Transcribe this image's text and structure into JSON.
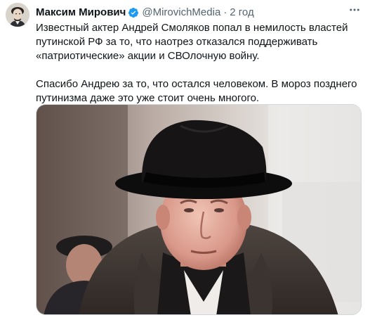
{
  "author": {
    "display_name": "Максим Мирович",
    "handle": "@MirovichMedia",
    "separator": "·",
    "time": "2 год",
    "verified_icon": "verified-badge-icon",
    "avatar_icon": "avatar-portrait"
  },
  "tweet": {
    "paragraph_1": "Известный актер Андрей Смоляков попал в немилость властей путинской РФ за то, что наотрез отказался поддерживать «патриотические» акции и СВОлочную войну.",
    "paragraph_2": "Спасибо Андрею за то, что остался человеком. В мороз позднего путинизма даже это уже стоит очень многого."
  },
  "media": {
    "icon": "photo-man-in-black-hat"
  },
  "menu": {
    "icon": "more-options-icon"
  },
  "colors": {
    "text": "#0f1419",
    "secondary": "#536471",
    "verified": "#1d9bf0",
    "border": "#cfd9de"
  }
}
